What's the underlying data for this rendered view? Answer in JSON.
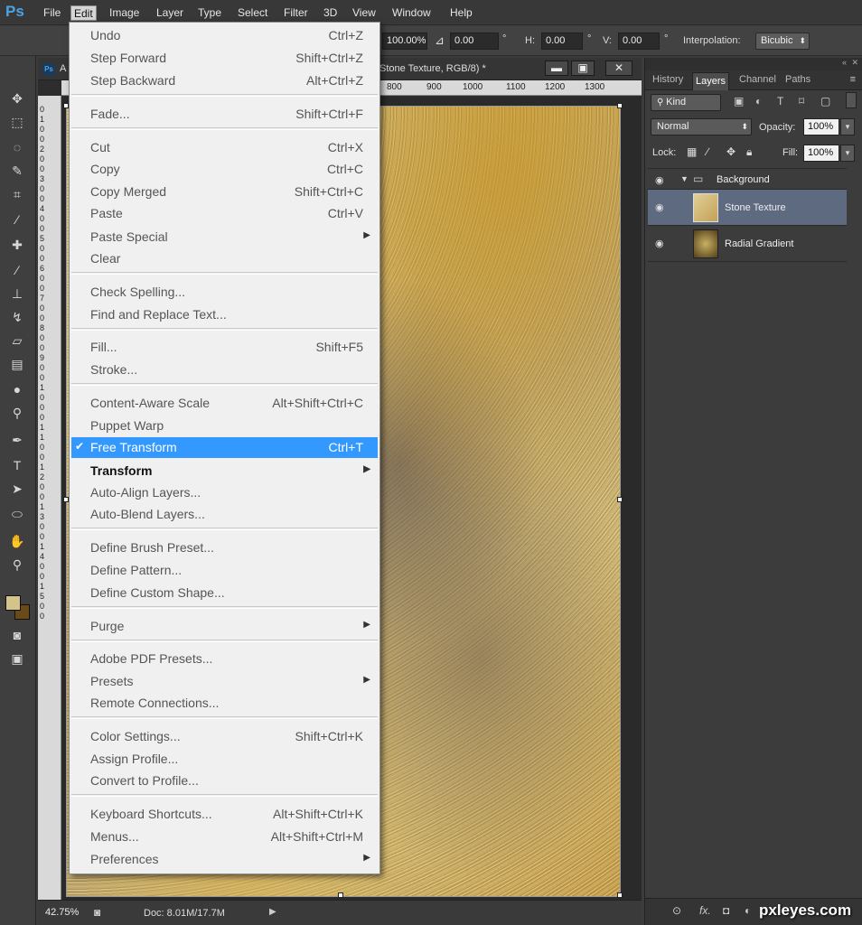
{
  "app": {
    "logo": "Ps",
    "menus": [
      "File",
      "Edit",
      "Image",
      "Layer",
      "Type",
      "Select",
      "Filter",
      "3D",
      "View",
      "Window",
      "Help"
    ],
    "active_menu": "Edit"
  },
  "options_bar": {
    "width_pct": "100.00%",
    "angle": "0.00",
    "angle_unit": "°",
    "h_label": "H:",
    "h_value": "0.00",
    "h_unit": "°",
    "v_label": "V:",
    "v_value": "0.00",
    "v_unit": "°",
    "interp_label": "Interpolation:",
    "interp_value": "Bicubic"
  },
  "document": {
    "title": "Stone Texture, RGB/8) *",
    "tab_prefix": "A",
    "ruler_top": [
      "800",
      "900",
      "1000",
      "1100",
      "1200",
      "1300"
    ],
    "ruler_left": "0 1 0 0 2 0 0 3 0 0 4 0 0 5 0 0 6 0 0 7 0 0 8 0 0 9 0 0 1 0 0 0 1 1 0 0 1 2 0 0 1 3 0 0 1 4 0 0 1 5 0 0",
    "zoom": "42.75%",
    "doc_size": "Doc: 8.01M/17.7M"
  },
  "edit_menu": {
    "items": [
      {
        "label": "Undo",
        "shortcut": "Ctrl+Z"
      },
      {
        "label": "Step Forward",
        "shortcut": "Shift+Ctrl+Z"
      },
      {
        "label": "Step Backward",
        "shortcut": "Alt+Ctrl+Z"
      },
      {
        "label": "Fade...",
        "shortcut": "Shift+Ctrl+F"
      },
      {
        "label": "Cut",
        "shortcut": "Ctrl+X"
      },
      {
        "label": "Copy",
        "shortcut": "Ctrl+C"
      },
      {
        "label": "Copy Merged",
        "shortcut": "Shift+Ctrl+C"
      },
      {
        "label": "Paste",
        "shortcut": "Ctrl+V"
      },
      {
        "label": "Paste Special",
        "shortcut": ""
      },
      {
        "label": "Clear",
        "shortcut": ""
      },
      {
        "label": "Check Spelling...",
        "shortcut": ""
      },
      {
        "label": "Find and Replace Text...",
        "shortcut": ""
      },
      {
        "label": "Fill...",
        "shortcut": "Shift+F5"
      },
      {
        "label": "Stroke...",
        "shortcut": ""
      },
      {
        "label": "Content-Aware Scale",
        "shortcut": "Alt+Shift+Ctrl+C"
      },
      {
        "label": "Puppet Warp",
        "shortcut": ""
      },
      {
        "label": "Free Transform",
        "shortcut": "Ctrl+T"
      },
      {
        "label": "Transform",
        "shortcut": ""
      },
      {
        "label": "Auto-Align Layers...",
        "shortcut": ""
      },
      {
        "label": "Auto-Blend Layers...",
        "shortcut": ""
      },
      {
        "label": "Define Brush Preset...",
        "shortcut": ""
      },
      {
        "label": "Define Pattern...",
        "shortcut": ""
      },
      {
        "label": "Define Custom Shape...",
        "shortcut": ""
      },
      {
        "label": "Purge",
        "shortcut": ""
      },
      {
        "label": "Adobe PDF Presets...",
        "shortcut": ""
      },
      {
        "label": "Presets",
        "shortcut": ""
      },
      {
        "label": "Remote Connections...",
        "shortcut": ""
      },
      {
        "label": "Color Settings...",
        "shortcut": "Shift+Ctrl+K"
      },
      {
        "label": "Assign Profile...",
        "shortcut": ""
      },
      {
        "label": "Convert to Profile...",
        "shortcut": ""
      },
      {
        "label": "Keyboard Shortcuts...",
        "shortcut": "Alt+Shift+Ctrl+K"
      },
      {
        "label": "Menus...",
        "shortcut": "Alt+Shift+Ctrl+M"
      },
      {
        "label": "Preferences",
        "shortcut": ""
      }
    ],
    "selected": "Free Transform",
    "check_mark": "✔"
  },
  "layers_panel": {
    "tabs": [
      "History",
      "Layers",
      "Channel",
      "Paths"
    ],
    "active_tab": "Layers",
    "kind_label": "Kind",
    "blend_mode": "Normal",
    "opacity_label": "Opacity:",
    "opacity_value": "100%",
    "lock_label": "Lock:",
    "fill_label": "Fill:",
    "fill_value": "100%",
    "group_name": "Background",
    "layers": [
      {
        "name": "Stone Texture",
        "selected": true
      },
      {
        "name": "Radial Gradient",
        "selected": false
      }
    ]
  },
  "watermark": "pxleyes.com",
  "colors": {
    "accent": "#3399ff",
    "foreground_swatch": "#d4c38a",
    "background_swatch": "#6a4b18",
    "selected_layer": "#5d6a80"
  }
}
